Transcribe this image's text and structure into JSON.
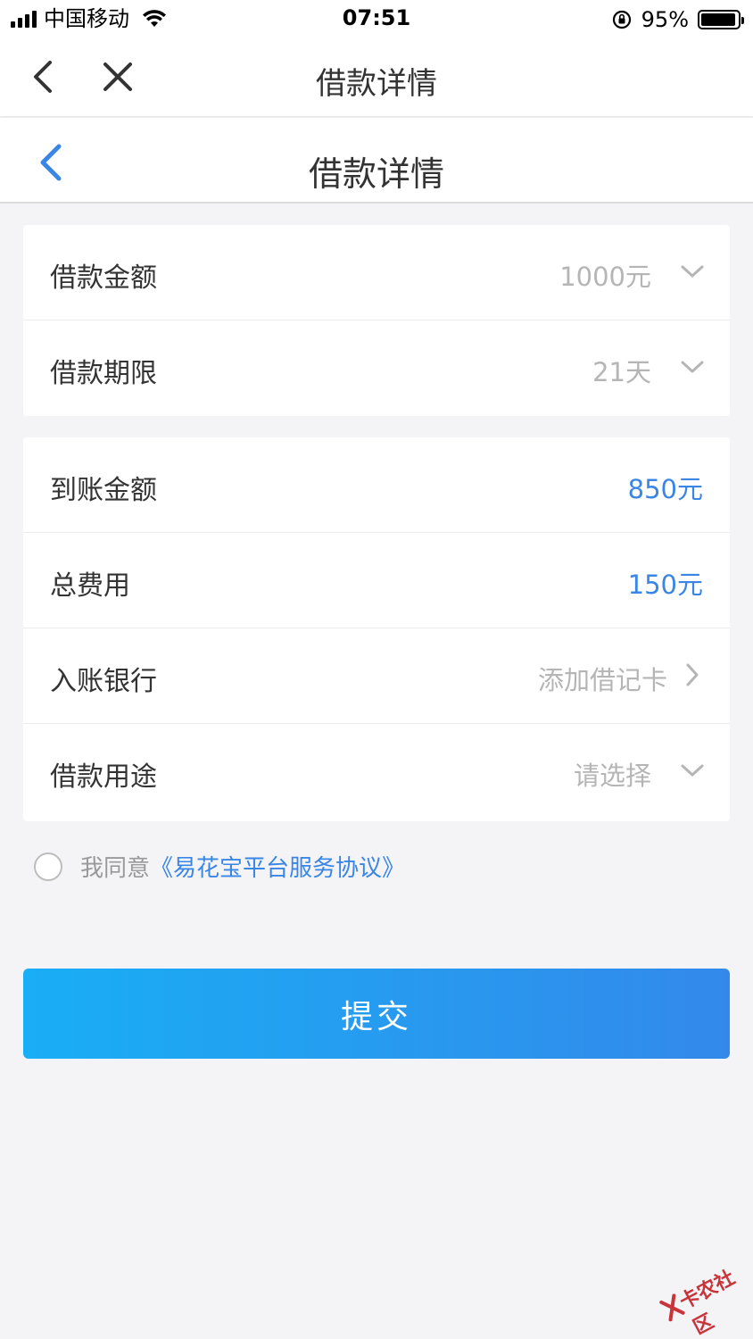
{
  "status_bar": {
    "carrier": "中国移动",
    "time": "07:51",
    "battery_pct": "95%",
    "battery_level": 0.95
  },
  "top_nav": {
    "title": "借款详情",
    "back_icon": "chevron-left-icon",
    "close_icon": "close-icon"
  },
  "inner_header": {
    "title": "借款详情",
    "back_icon": "chevron-left-icon",
    "accent": "#3a86e6"
  },
  "loan_card": {
    "rows": [
      {
        "label": "借款金额",
        "value": "1000元",
        "icon": "chevron-down-icon"
      },
      {
        "label": "借款期限",
        "value": "21天",
        "icon": "chevron-down-icon"
      }
    ]
  },
  "detail_card": {
    "rows": [
      {
        "label": "到账金额",
        "value": "850元"
      },
      {
        "label": "总费用",
        "value": "150元"
      },
      {
        "label": "入账银行",
        "value": "添加借记卡",
        "icon": "chevron-right-icon"
      },
      {
        "label": "借款用途",
        "value": "请选择",
        "icon": "chevron-down-icon"
      }
    ]
  },
  "agreement": {
    "prefix": "我同意",
    "link": "《易花宝平台服务协议》",
    "checked": false
  },
  "submit": {
    "label": "提交"
  },
  "watermark": {
    "text": "卡农社区"
  },
  "colors": {
    "primary_blue": "#3a86e6",
    "button_gradient_start": "#19aef5",
    "button_gradient_end": "#3389ea",
    "placeholder_gray": "#b5b5b5"
  }
}
